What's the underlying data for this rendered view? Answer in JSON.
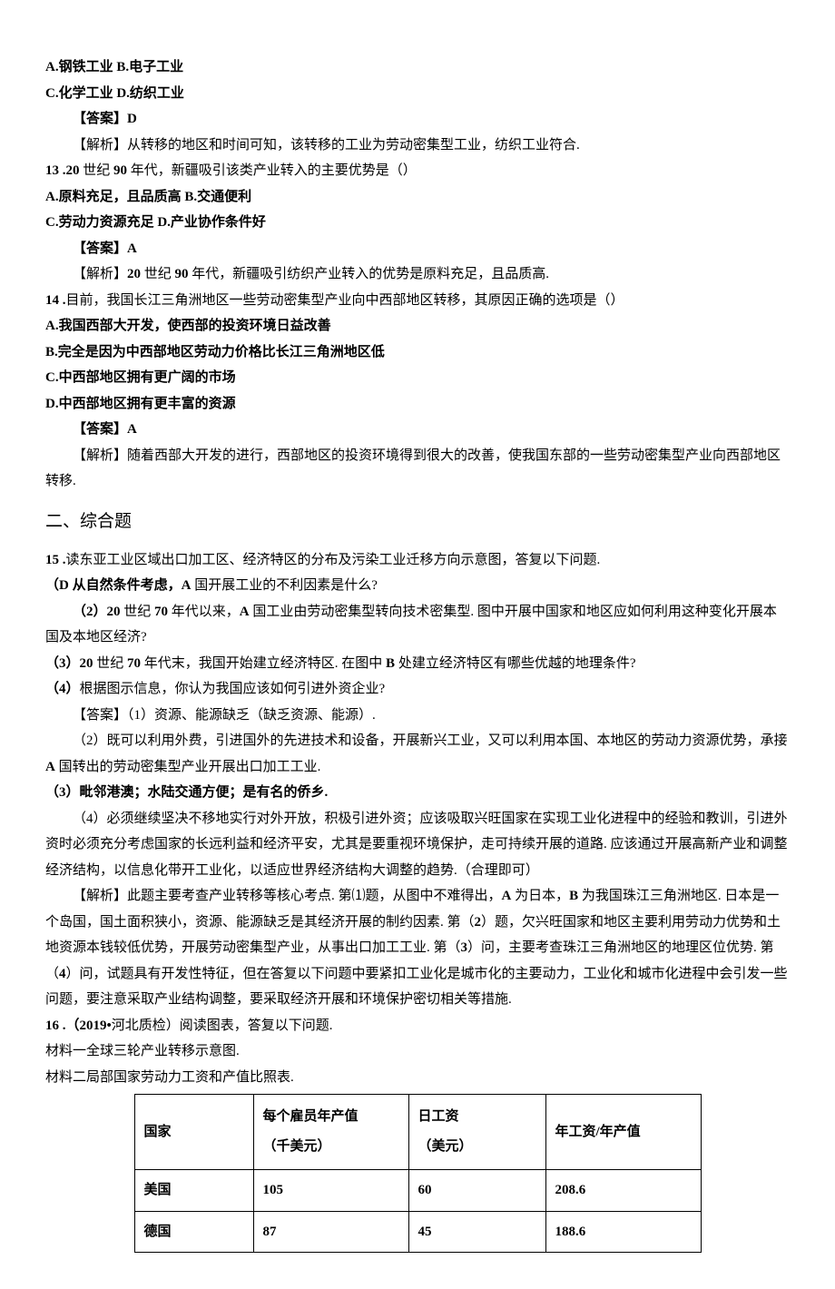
{
  "lines": {
    "l1": "A.钢铁工业 B.电子工业",
    "l2": "C.化学工业 D.纺织工业",
    "l3": "【答案】D",
    "l4": "【解析】从转移的地区和时间可知，该转移的工业为劳动密集型工业，纺织工业符合.",
    "l5a": "13  .20",
    "l5b": " 世纪 ",
    "l5c": "90",
    "l5d": " 年代，新疆吸引该类产业转入的主要优势是（）",
    "l6": "A.原料充足，且品质高 B.交通便利",
    "l7": "C.劳动力资源充足 D.产业协作条件好",
    "l8": "【答案】A",
    "l9a": "【解析】",
    "l9b": "20",
    "l9c": " 世纪 ",
    "l9d": "90",
    "l9e": " 年代，新疆吸引纺织产业转入的优势是原料充足，且品质高.",
    "l10a": "14  .",
    "l10b": "目前，我国长江三角洲地区一些劳动密集型产业向中西部地区转移，其原因正确的选项是（）",
    "l11": "A.我国西部大开发，使西部的投资环境日益改善",
    "l12": "B.完全是因为中西部地区劳动力价格比长江三角洲地区低",
    "l13": "C.中西部地区拥有更广阔的市场",
    "l14": "D.中西部地区拥有更丰富的资源",
    "l15": "【答案】A",
    "l16": "【解析】随着西部大开发的进行，西部地区的投资环境得到很大的改善，使我国东部的一些劳动密集型产业向西部地区转移.",
    "sec2": "二、综合题",
    "l17a": "15  .",
    "l17b": "读东亚工业区域出口加工区、经济特区的分布及污染工业迁移方向示意图，答复以下问题.",
    "l18a": "（D 从自然条件考虑，",
    "l18b": "A",
    "l18c": " 国开展工业的不利因素是什么?",
    "l19a": "（2）20",
    "l19b": " 世纪 ",
    "l19c": "70",
    "l19d": " 年代以来，",
    "l19e": "A",
    "l19f": " 国工业由劳动密集型转向技术密集型. 图中开展中国家和地区应如何利用这种变化开展本国及本地区经济?",
    "l20a": "（3）20",
    "l20b": " 世纪 ",
    "l20c": "70",
    "l20d": " 年代末，我国开始建立经济特区. 在图中 ",
    "l20e": "B",
    "l20f": " 处建立经济特区有哪些优越的地理条件?",
    "l21a": "（4）",
    "l21b": "根据图示信息，你认为我国应该如何引进外资企业?",
    "l22": "【答案】（1）资源、能源缺乏（缺乏资源、能源）.",
    "l23a": "（2）既可以利用外费，引进国外的先进技术和设备，开展新兴工业，又可以利用本国、本地区的劳动力资源优势，承接 ",
    "l23b": "A",
    "l23c": " 国转出的劳动密集型产业开展出口加工工业.",
    "l24": "（3）毗邻港澳；水陆交通方便；是有名的侨乡.",
    "l25": "（4）必须继续坚决不移地实行对外开放，积极引进外资；应该吸取兴旺国家在实现工业化进程中的经验和教训，引进外资时必须充分考虑国家的长远利益和经济平安，尤其是要重视环境保护，走可持续开展的道路. 应该通过开展高新产业和调整经济结构，以信息化带开工业化，以适应世界经济结构大调整的趋势.（合理即可）",
    "l26a": "【解析】此题主要考查产业转移等核心考点. 第⑴题，从图中不难得出，",
    "l26b": "A",
    "l26c": " 为日本，",
    "l26d": "B",
    "l26e": " 为我国珠江三角洲地区. 日本是一个岛国，国土面积狭小，资源、能源缺乏是其经济开展的制约因素. 第（",
    "l26f": "2",
    "l26g": "）题，欠兴旺国家和地区主要利用劳动力优势和土地资源本钱较低优势，开展劳动密集型产业，从事出口加工工业. 第（",
    "l26h": "3",
    "l26i": "）问，主要考查珠江三角洲地区的地理区位优势. 第（",
    "l26j": "4",
    "l26k": "）问，试题具有开发性特征，但在答复以下问题中要紧扣工业化是城市化的主要动力，工业化和城市化进程中会引发一些问题，要注意采取产业结构调整，要采取经济开展和环境保护密切相关等措施.",
    "l27a": "16  .（2019•",
    "l27b": "河北质检）阅读图表，答复以下问题.",
    "l28": "材料一全球三轮产业转移示意图.",
    "l29": "材料二局部国家劳动力工资和产值比照表."
  },
  "table": {
    "h1": "国家",
    "h2a": "每个雇员年产值",
    "h2b": "（千美元）",
    "h3a": "日工资",
    "h3b": "（美元）",
    "h4": "年工资/年产值",
    "r1c1": "美国",
    "r1c2": "105",
    "r1c3": "60",
    "r1c4": "208.6",
    "r2c1": "德国",
    "r2c2": "87",
    "r2c3": "45",
    "r2c4": "188.6"
  }
}
